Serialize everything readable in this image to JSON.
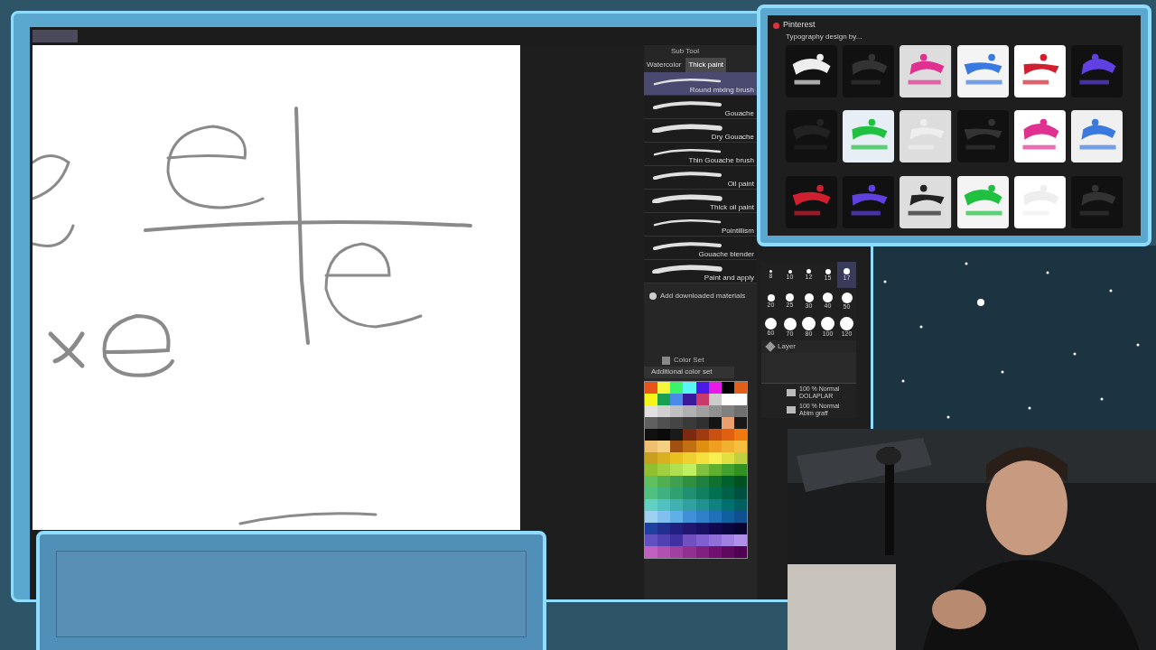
{
  "sub_tool": {
    "title": "Sub Tool",
    "tabs": [
      {
        "label": "Watercolor",
        "selected": false
      },
      {
        "label": "Thick paint",
        "selected": true
      }
    ],
    "brushes": [
      {
        "name": "Round mixing brush",
        "selected": true
      },
      {
        "name": "Gouache",
        "selected": false
      },
      {
        "name": "Dry Gouache",
        "selected": false
      },
      {
        "name": "Thin Gouache brush",
        "selected": false
      },
      {
        "name": "Oil paint",
        "selected": false
      },
      {
        "name": "Thick oil paint",
        "selected": false
      },
      {
        "name": "Pointillism",
        "selected": false
      },
      {
        "name": "Gouache blender",
        "selected": false
      },
      {
        "name": "Paint and apply",
        "selected": false
      }
    ],
    "add_materials": "Add downloaded materials"
  },
  "color_set": {
    "title": "Color Set",
    "set_name": "Additional color set",
    "rows": [
      {
        "swatches": [
          {
            "color": "#e8551a"
          },
          {
            "color": "#f5f53a"
          },
          {
            "color": "#3af56a"
          },
          {
            "color": "#5af5f5"
          },
          {
            "color": "#4a1ae8"
          },
          {
            "color": "#e81ae8"
          },
          {
            "color": "#000000"
          },
          {
            "color": "#e0601a"
          }
        ]
      },
      {
        "swatches": [
          {
            "color": "#f5f51a"
          },
          {
            "color": "#1aa050"
          },
          {
            "color": "#4a8ae8"
          },
          {
            "color": "#3a1a9a"
          },
          {
            "color": "#c83a6a"
          },
          {
            "color": "#cccccc"
          },
          {
            "color": "#ffffff"
          },
          {
            "color": "#ffffff"
          }
        ]
      },
      {
        "swatches": [
          {
            "color": "#e0e0e0"
          },
          {
            "color": "#d0d0d0"
          },
          {
            "color": "#c0c0c0"
          },
          {
            "color": "#b0b0b0"
          },
          {
            "color": "#a0a0a0"
          },
          {
            "color": "#909090"
          },
          {
            "color": "#808080"
          },
          {
            "color": "#707070"
          }
        ]
      },
      {
        "swatches": [
          {
            "color": "#606060"
          },
          {
            "color": "#505050"
          },
          {
            "color": "#454545"
          },
          {
            "color": "#3a3a3a"
          },
          {
            "color": "#303030"
          },
          {
            "color": "#141414"
          },
          {
            "color": "#e8a070"
          },
          {
            "color": "#181818"
          }
        ]
      },
      {
        "swatches": [
          {
            "color": "#101010"
          },
          {
            "color": "#0a0a0a"
          },
          {
            "color": "#1a1a1a"
          },
          {
            "color": "#7a2a10"
          },
          {
            "color": "#a03a10"
          },
          {
            "color": "#c85010"
          },
          {
            "color": "#e06010"
          },
          {
            "color": "#f07a10"
          }
        ]
      },
      {
        "swatches": [
          {
            "color": "#f0c070"
          },
          {
            "color": "#f5d080"
          },
          {
            "color": "#a05010"
          },
          {
            "color": "#c07010"
          },
          {
            "color": "#e09010"
          },
          {
            "color": "#f0a020"
          },
          {
            "color": "#f0b030"
          },
          {
            "color": "#f5c040"
          }
        ]
      },
      {
        "swatches": [
          {
            "color": "#c8a020"
          },
          {
            "color": "#d8b020"
          },
          {
            "color": "#e8c020"
          },
          {
            "color": "#f0d030"
          },
          {
            "color": "#f5e040"
          },
          {
            "color": "#f5f050"
          },
          {
            "color": "#e0e040"
          },
          {
            "color": "#c0d040"
          }
        ]
      },
      {
        "swatches": [
          {
            "color": "#90c030"
          },
          {
            "color": "#a0d040"
          },
          {
            "color": "#b0e050"
          },
          {
            "color": "#c0f060"
          },
          {
            "color": "#80c040"
          },
          {
            "color": "#60b030"
          },
          {
            "color": "#40a030"
          },
          {
            "color": "#309020"
          }
        ]
      },
      {
        "swatches": [
          {
            "color": "#60c060"
          },
          {
            "color": "#50b050"
          },
          {
            "color": "#40a050"
          },
          {
            "color": "#309040"
          },
          {
            "color": "#208040"
          },
          {
            "color": "#107030"
          },
          {
            "color": "#006030"
          },
          {
            "color": "#005020"
          }
        ]
      },
      {
        "swatches": [
          {
            "color": "#50c080"
          },
          {
            "color": "#40b080"
          },
          {
            "color": "#30a070"
          },
          {
            "color": "#209070"
          },
          {
            "color": "#108060"
          },
          {
            "color": "#007050"
          },
          {
            "color": "#006048"
          },
          {
            "color": "#005040"
          }
        ]
      },
      {
        "swatches": [
          {
            "color": "#60d0c0"
          },
          {
            "color": "#50c0c0"
          },
          {
            "color": "#40b0b0"
          },
          {
            "color": "#30a0a0"
          },
          {
            "color": "#209090"
          },
          {
            "color": "#108080"
          },
          {
            "color": "#007070"
          },
          {
            "color": "#006060"
          }
        ]
      },
      {
        "swatches": [
          {
            "color": "#a0d0f0"
          },
          {
            "color": "#80c0f0"
          },
          {
            "color": "#60b0e8"
          },
          {
            "color": "#4090d8"
          },
          {
            "color": "#3080c8"
          },
          {
            "color": "#2070b8"
          },
          {
            "color": "#1060a0"
          },
          {
            "color": "#105090"
          }
        ]
      },
      {
        "swatches": [
          {
            "color": "#2040a0"
          },
          {
            "color": "#203090"
          },
          {
            "color": "#202080"
          },
          {
            "color": "#201870"
          },
          {
            "color": "#181060"
          },
          {
            "color": "#100850"
          },
          {
            "color": "#0a0640"
          },
          {
            "color": "#080430"
          }
        ]
      },
      {
        "swatches": [
          {
            "color": "#6050c0"
          },
          {
            "color": "#5040b0"
          },
          {
            "color": "#4030a0"
          },
          {
            "color": "#7050c0"
          },
          {
            "color": "#8060d0"
          },
          {
            "color": "#9070d8"
          },
          {
            "color": "#a080e0"
          },
          {
            "color": "#b090e8"
          }
        ]
      },
      {
        "swatches": [
          {
            "color": "#c060c0"
          },
          {
            "color": "#b050b0"
          },
          {
            "color": "#a040a0"
          },
          {
            "color": "#903090"
          },
          {
            "color": "#802080"
          },
          {
            "color": "#701070"
          },
          {
            "color": "#600860"
          },
          {
            "color": "#500050"
          }
        ]
      }
    ]
  },
  "brush_sizes": [
    {
      "label": "8",
      "selected": false
    },
    {
      "label": "10",
      "selected": false
    },
    {
      "label": "12",
      "selected": false
    },
    {
      "label": "15",
      "selected": false
    },
    {
      "label": "17",
      "selected": true
    },
    {
      "label": "20",
      "selected": false
    },
    {
      "label": "25",
      "selected": false
    },
    {
      "label": "30",
      "selected": false
    },
    {
      "label": "40",
      "selected": false
    },
    {
      "label": "50",
      "selected": false
    },
    {
      "label": "60",
      "selected": false
    },
    {
      "label": "70",
      "selected": false
    },
    {
      "label": "80",
      "selected": false
    },
    {
      "label": "100",
      "selected": false
    },
    {
      "label": "120",
      "selected": false
    }
  ],
  "layer_panel": {
    "title": "Layer",
    "layers": [
      {
        "info": "100 % Normal",
        "name": "DOLAPLAR"
      },
      {
        "info": "100 % Normal",
        "name": "Abim graff"
      }
    ]
  },
  "pinterest": {
    "app": "Pinterest",
    "caption": "Typography design by..."
  }
}
